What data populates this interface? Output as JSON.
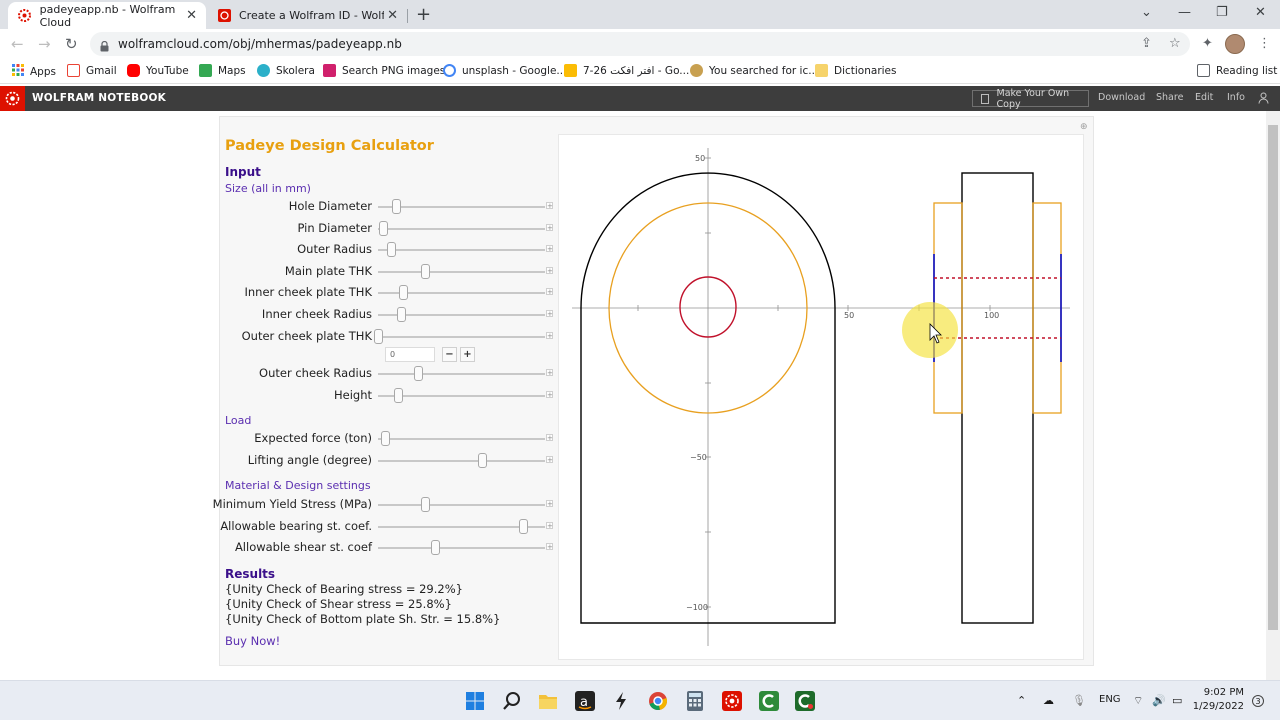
{
  "browser": {
    "tabs": [
      {
        "title": "padeyeapp.nb - Wolfram Cloud",
        "active": true
      },
      {
        "title": "Create a Wolfram ID - Wolfram C",
        "active": false
      }
    ],
    "new_tab": "+",
    "close_glyph": "✕",
    "url": "wolframcloud.com/obj/mhermas/padeyeapp.nb",
    "bookmarks": [
      {
        "label": "Apps",
        "color": "#4285f4"
      },
      {
        "label": "Gmail",
        "color": "#ea4335"
      },
      {
        "label": "YouTube",
        "color": "#ff0000"
      },
      {
        "label": "Maps",
        "color": "#34a853"
      },
      {
        "label": "Skolera",
        "color": "#2bb0c9"
      },
      {
        "label": "Search PNG images",
        "color": "#d0206c"
      },
      {
        "label": "unsplash - Google...",
        "color": "#4285f4"
      },
      {
        "label": "7-26 افتر افكت - Go...",
        "color": "#fbbc04"
      },
      {
        "label": "You searched for ic...",
        "color": "#c8a050"
      },
      {
        "label": "Dictionaries",
        "color": "#f6d36b"
      }
    ],
    "reading_list": "Reading list"
  },
  "wolfram": {
    "header_title": "WOLFRAM NOTEBOOK",
    "copy_button": "Make Your Own Copy",
    "links": [
      "Download",
      "Share",
      "Edit",
      "Info"
    ],
    "brand_color": "#dd1100"
  },
  "calculator": {
    "title": "Padeye Design Calculator",
    "input_heading": "Input",
    "size_heading": "Size (all in mm)",
    "size_controls": [
      {
        "label": "Hole Diameter",
        "value": 0.11
      },
      {
        "label": "Pin Diameter",
        "value": 0.03
      },
      {
        "label": "Outer Radius",
        "value": 0.08
      },
      {
        "label": "Main plate THK",
        "value": 0.28
      },
      {
        "label": "Inner cheek plate THK",
        "value": 0.15
      },
      {
        "label": "Inner cheek Radius",
        "value": 0.14
      },
      {
        "label": "Outer cheek plate THK",
        "value": 0.0
      }
    ],
    "outer_cheek_value": "0",
    "minus": "−",
    "plus": "+",
    "size_controls_2": [
      {
        "label": "Outer cheek Radius",
        "value": 0.24
      },
      {
        "label": "Height",
        "value": 0.12
      }
    ],
    "load_heading": "Load",
    "load_controls": [
      {
        "label": "Expected force (ton)",
        "value": 0.04
      },
      {
        "label": "Lifting angle (degree)",
        "value": 0.62
      }
    ],
    "material_heading": "Material & Design settings",
    "material_controls": [
      {
        "label": "Minimum Yield Stress (MPa)",
        "value": 0.28
      },
      {
        "label": "Allowable bearing st. coef.",
        "value": 0.87
      },
      {
        "label": "Allowable shear st. coef",
        "value": 0.34
      }
    ],
    "results_heading": "Results",
    "results": [
      "{Unity Check of Bearing stress = 29.2%}",
      "{Unity Check of Shear stress =  25.8%}",
      "{Unity Check of Bottom plate Sh. Str. = 15.8%}"
    ],
    "buy_now": "Buy Now!"
  },
  "plot": {
    "x_ticks": [
      "50",
      "100"
    ],
    "y_ticks": [
      "50",
      "−50",
      "−100"
    ],
    "colors": {
      "outline": "#000000",
      "cheek": "#e8a020",
      "hole": "#c0102a",
      "pin": "#2020c0"
    }
  },
  "taskbar": {
    "language": "ENG",
    "time": "9:02 PM",
    "date": "1/29/2022"
  }
}
